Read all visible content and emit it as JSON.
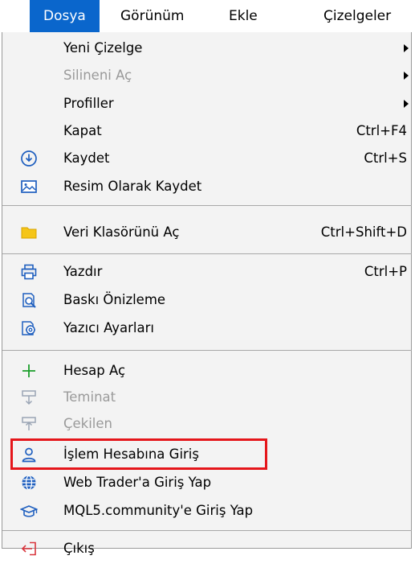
{
  "menubar": {
    "items": [
      {
        "label": "Dosya"
      },
      {
        "label": "Görünüm"
      },
      {
        "label": "Ekle"
      },
      {
        "label": "Çizelgeler"
      }
    ]
  },
  "menu": {
    "items": [
      {
        "label": "Yeni Çizelge",
        "shortcut": "",
        "submenu": true,
        "enabled": true,
        "icon": ""
      },
      {
        "label": "Silineni Aç",
        "shortcut": "",
        "submenu": true,
        "enabled": false,
        "icon": ""
      },
      {
        "label": "Profiller",
        "shortcut": "",
        "submenu": true,
        "enabled": true,
        "icon": ""
      },
      {
        "label": "Kapat",
        "shortcut": "Ctrl+F4",
        "submenu": false,
        "enabled": true,
        "icon": ""
      },
      {
        "label": "Kaydet",
        "shortcut": "Ctrl+S",
        "submenu": false,
        "enabled": true,
        "icon": "save-icon"
      },
      {
        "label": "Resim Olarak Kaydet",
        "shortcut": "",
        "submenu": false,
        "enabled": true,
        "icon": "image-icon"
      },
      {
        "label": "Veri Klasörünü Aç",
        "shortcut": "Ctrl+Shift+D",
        "submenu": false,
        "enabled": true,
        "icon": "folder-icon"
      },
      {
        "label": "Yazdır",
        "shortcut": "Ctrl+P",
        "submenu": false,
        "enabled": true,
        "icon": "printer-icon"
      },
      {
        "label": "Baskı Önizleme",
        "shortcut": "",
        "submenu": false,
        "enabled": true,
        "icon": "print-preview-icon"
      },
      {
        "label": "Yazıcı Ayarları",
        "shortcut": "",
        "submenu": false,
        "enabled": true,
        "icon": "printer-settings-icon"
      },
      {
        "label": "Hesap Aç",
        "shortcut": "",
        "submenu": false,
        "enabled": true,
        "icon": "plus-icon"
      },
      {
        "label": "Teminat",
        "shortcut": "",
        "submenu": false,
        "enabled": false,
        "icon": "deposit-icon"
      },
      {
        "label": "Çekilen",
        "shortcut": "",
        "submenu": false,
        "enabled": false,
        "icon": "withdraw-icon"
      },
      {
        "label": "İşlem Hesabına Giriş",
        "shortcut": "",
        "submenu": false,
        "enabled": true,
        "icon": "user-icon"
      },
      {
        "label": "Web Trader'a Giriş Yap",
        "shortcut": "",
        "submenu": false,
        "enabled": true,
        "icon": "globe-icon"
      },
      {
        "label": "MQL5.community'e Giriş Yap",
        "shortcut": "",
        "submenu": false,
        "enabled": true,
        "icon": "graduation-cap-icon"
      },
      {
        "label": "Çıkış",
        "shortcut": "",
        "submenu": false,
        "enabled": true,
        "icon": "exit-icon"
      }
    ]
  },
  "colors": {
    "menubar_active": "#0a66cc",
    "menu_background": "#f3f3f3",
    "disabled_text": "#9a9a9a",
    "highlight_border": "#e5161b",
    "folder_yellow": "#f5c518",
    "icon_blue": "#1f5fbf",
    "plus_green": "#1a9e2a",
    "exit_red": "#d9363e"
  }
}
